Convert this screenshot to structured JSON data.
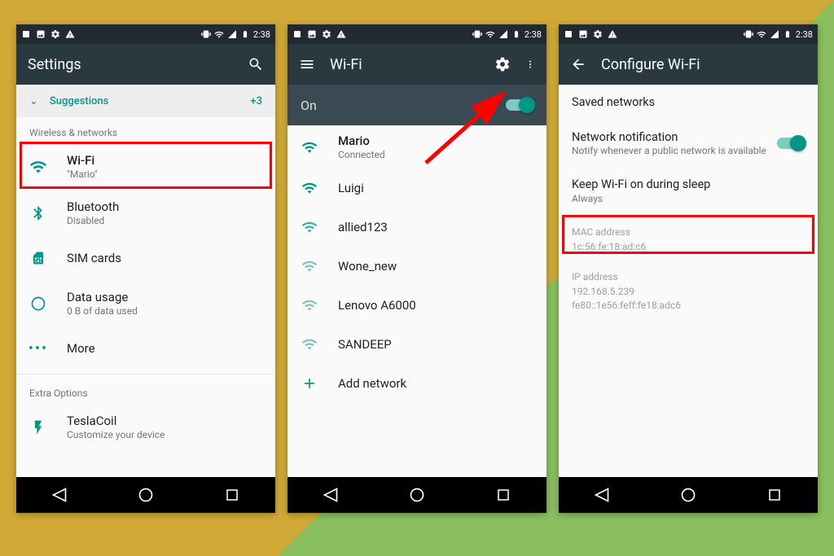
{
  "statusbar": {
    "time": "2:38"
  },
  "phone1": {
    "title": "Settings",
    "suggestions": {
      "label": "Suggestions",
      "count": "+3"
    },
    "section_wireless": "Wireless & networks",
    "items": {
      "wifi": {
        "label": "Wi-Fi",
        "sub": "\"Mario\""
      },
      "bluetooth": {
        "label": "Bluetooth",
        "sub": "Disabled"
      },
      "sim": {
        "label": "SIM cards"
      },
      "data": {
        "label": "Data usage",
        "sub": "0 B of data used"
      },
      "more": {
        "label": "More"
      }
    },
    "section_extra": "Extra Options",
    "tesla": {
      "label": "TeslaCoil",
      "sub": "Customize your device"
    }
  },
  "phone2": {
    "title": "Wi-Fi",
    "on_label": "On",
    "networks": [
      {
        "name": "Mario",
        "sub": "Connected",
        "strength": 4
      },
      {
        "name": "Luigi",
        "strength": 4
      },
      {
        "name": "allied123",
        "strength": 3
      },
      {
        "name": "Wone_new",
        "strength": 2
      },
      {
        "name": "Lenovo A6000",
        "strength": 2
      },
      {
        "name": "SANDEEP",
        "strength": 2
      }
    ],
    "add_network": "Add network"
  },
  "phone3": {
    "title": "Configure Wi-Fi",
    "saved": "Saved networks",
    "notif": {
      "label": "Network notification",
      "sub": "Notify whenever a public network is available"
    },
    "sleep": {
      "label": "Keep Wi-Fi on during sleep",
      "sub": "Always"
    },
    "mac": {
      "label": "MAC address",
      "sub": "1c:56:fe:18:ad:c6"
    },
    "ip": {
      "label": "IP address",
      "sub": "192.168.5.239\nfe80::1e56:feff:fe18:adc6"
    }
  }
}
